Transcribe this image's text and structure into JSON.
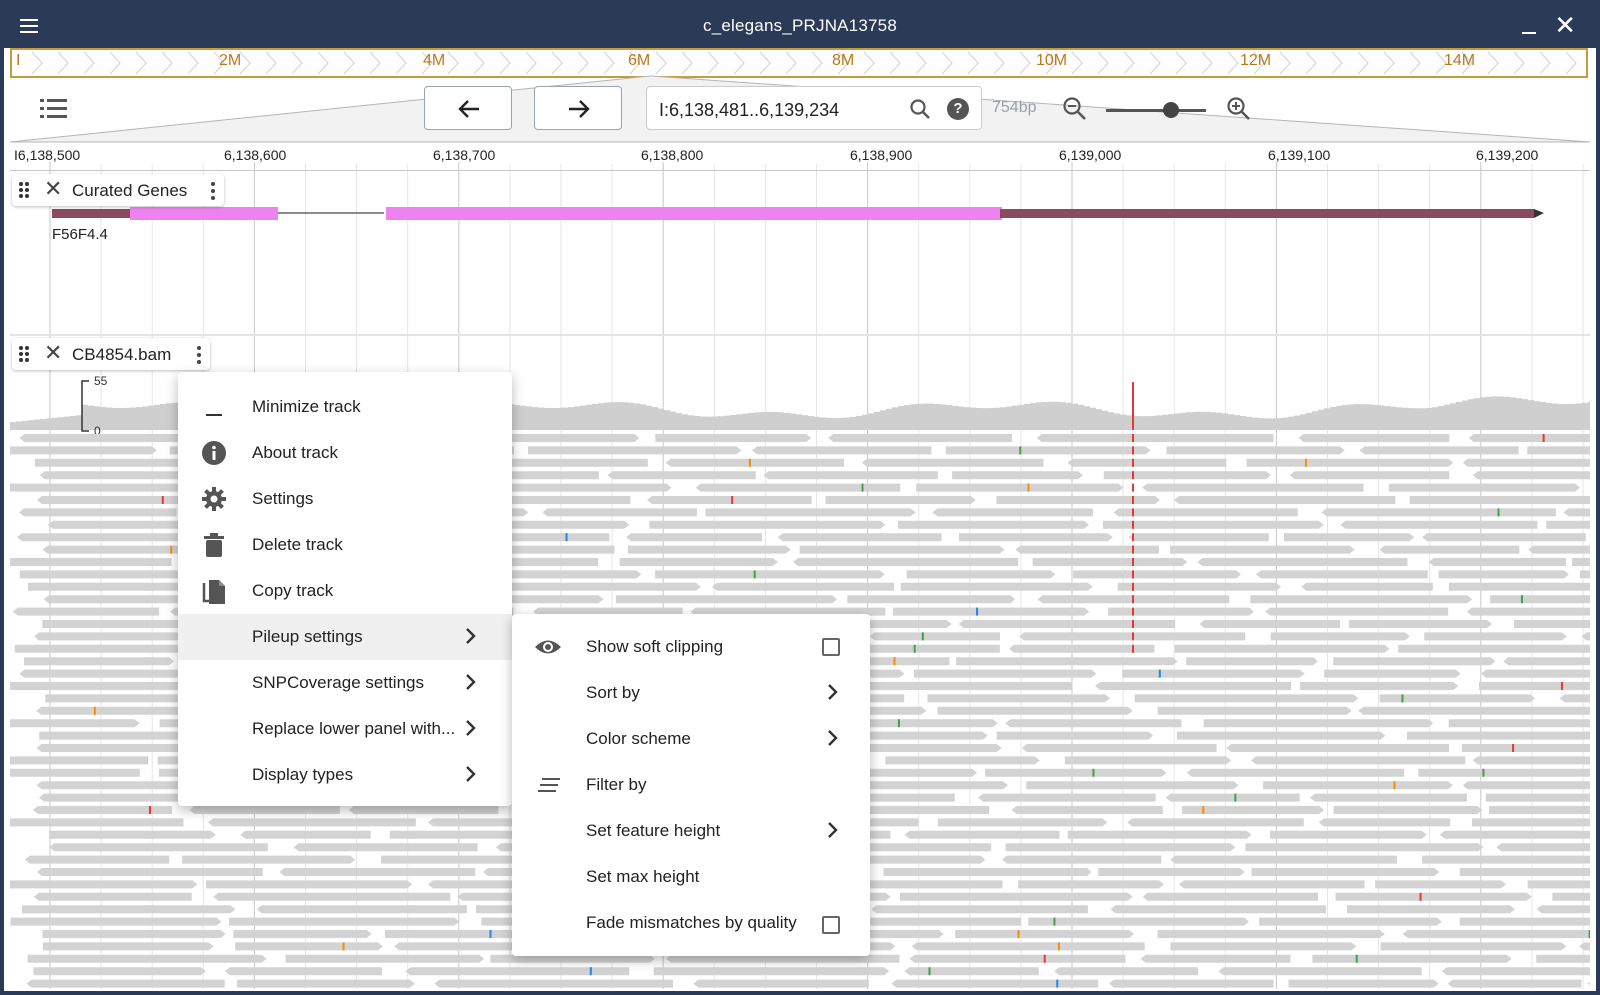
{
  "window": {
    "title": "c_elegans_PRJNA13758"
  },
  "overview": {
    "ticks": [
      "I",
      "2M",
      "4M",
      "6M",
      "8M",
      "10M",
      "12M",
      "14M"
    ]
  },
  "toolbar": {
    "location": "I:6,138,481..6,139,234",
    "bp_size": "754bp",
    "zoom_level": 0.65
  },
  "ruler": {
    "labels": [
      "I6,138,500",
      "6,138,600",
      "6,138,700",
      "6,138,800",
      "6,138,900",
      "6,139,000",
      "6,139,100",
      "6,139,200"
    ]
  },
  "tracks": {
    "curated_genes": {
      "name": "Curated Genes",
      "gene": "F56F4.4"
    },
    "bam": {
      "name": "CB4854.bam",
      "scale_max": "55",
      "scale_min": "0"
    }
  },
  "track_menu": {
    "items": [
      {
        "label": "Minimize track",
        "icon": "minimize-icon"
      },
      {
        "label": "About track",
        "icon": "info-icon"
      },
      {
        "label": "Settings",
        "icon": "gear-icon"
      },
      {
        "label": "Delete track",
        "icon": "trash-icon"
      },
      {
        "label": "Copy track",
        "icon": "copy-icon"
      },
      {
        "label": "Pileup settings",
        "submenu": true
      },
      {
        "label": "SNPCoverage settings",
        "submenu": true
      },
      {
        "label": "Replace lower panel with...",
        "submenu": true
      },
      {
        "label": "Display types",
        "submenu": true
      }
    ]
  },
  "pileup_menu": {
    "items": [
      {
        "label": "Show soft clipping",
        "icon": "eye-icon",
        "checked": false
      },
      {
        "label": "Sort by",
        "submenu": true
      },
      {
        "label": "Color scheme",
        "submenu": true
      },
      {
        "label": "Filter by",
        "icon": "filter-icon"
      },
      {
        "label": "Set feature height",
        "submenu": true
      },
      {
        "label": "Set max height"
      },
      {
        "label": "Fade mismatches by quality",
        "checked": false
      }
    ]
  },
  "colors": {
    "titlebar": "#2b3b57",
    "overview_border": "#c79a3a",
    "cds": "#ee82ee",
    "utr": "#8a4a5f",
    "read": "#d3d3d3",
    "mismatch_t": "#e53935",
    "mismatch_a": "#43a047",
    "mismatch_c": "#1e88e5",
    "mismatch_g": "#fb8c00"
  }
}
